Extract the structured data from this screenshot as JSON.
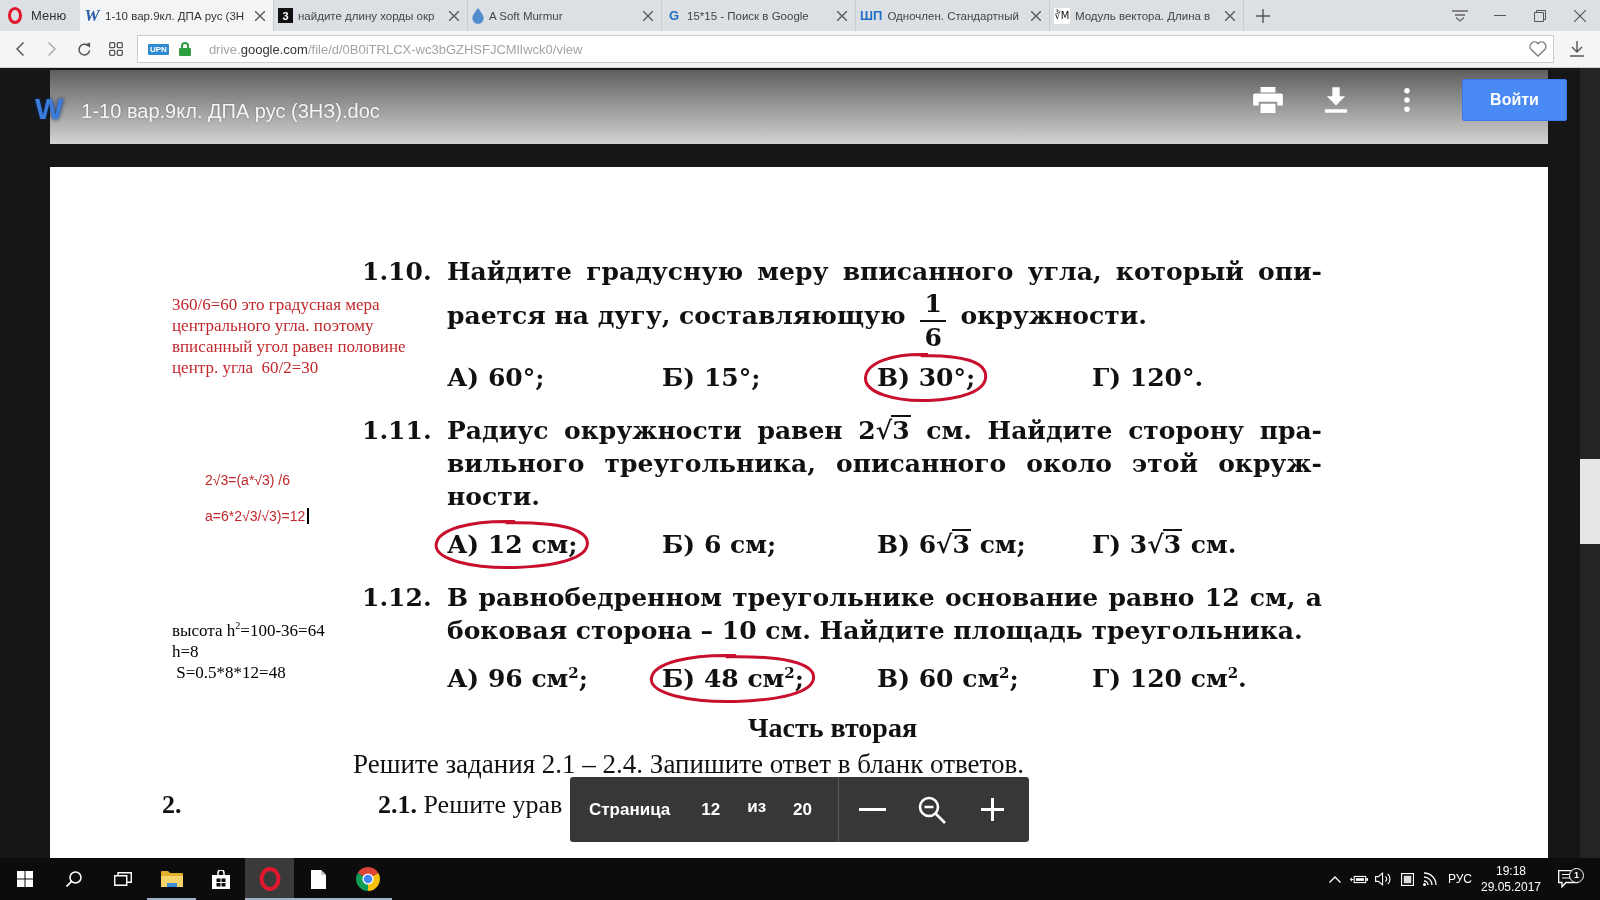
{
  "browser": {
    "menu_label": "Меню",
    "tabs": [
      {
        "label": "1-10 вар.9кл. ДПА рус (3Н",
        "kind": "word",
        "favicon_text": "W",
        "selected": true
      },
      {
        "label": "найдите длину хорды окр",
        "kind": "square",
        "favicon_text": "3",
        "selected": false
      },
      {
        "label": "A Soft Murmur",
        "kind": "drop",
        "selected": false
      },
      {
        "label": "15*15 - Поиск в Google",
        "kind": "letter",
        "favicon_text": "G",
        "selected": false
      },
      {
        "label": "Одночлен. Стандартный",
        "kind": "letter",
        "favicon_text": "ШП",
        "selected": false
      },
      {
        "label": "Модуль вектора. Длина в",
        "kind": "math",
        "favicon_text": "∛M",
        "selected": false
      }
    ],
    "address": {
      "badge": "UPN",
      "secure": true,
      "url": {
        "subdomain": "drive.",
        "domain": "google.com",
        "path": "/file/d/0B0iTRLCX-wc3bGZHSFJCMlIwck0/view"
      }
    }
  },
  "viewer": {
    "logo_text": "W",
    "title": "1-10 вар.9кл. ДПА рус (3НЗ).doc",
    "sign_in": "Войти"
  },
  "document": {
    "questions": [
      {
        "number": "1.10.",
        "lines": [
          [
            {
              "kind": "text",
              "text": "Найдите градусную меру вписанного угла, который опи-"
            }
          ],
          [
            {
              "kind": "text",
              "text": "рается на дугу, составляющую "
            },
            {
              "kind": "fraction",
              "numerator": "1",
              "denominator": "6"
            },
            {
              "kind": "text",
              "text": " окружности."
            }
          ]
        ],
        "answers": [
          {
            "parts": [
              {
                "kind": "text",
                "text": "А) 60°;"
              }
            ],
            "circled": false
          },
          {
            "parts": [
              {
                "kind": "text",
                "text": "Б) 15°;"
              }
            ],
            "circled": false
          },
          {
            "parts": [
              {
                "kind": "text",
                "text": "В) 30°;"
              }
            ],
            "circled": true
          },
          {
            "parts": [
              {
                "kind": "text",
                "text": "Г) 120°."
              }
            ],
            "circled": false
          }
        ],
        "note": {
          "kind": "serif",
          "color": "#c0282d",
          "caret": false,
          "lines": [
            "360/6=60 это градусная мера",
            "центрального угла. поэтому",
            "вписанный угол равен половине",
            "центр. угла  60/2=30"
          ]
        }
      },
      {
        "number": "1.11.",
        "lines": [
          [
            {
              "kind": "text",
              "text": "Радиус окружности равен "
            },
            {
              "kind": "sqrt",
              "coefficient": "2",
              "sign": "√",
              "radicand": "3"
            },
            {
              "kind": "text",
              "text": " см. Найдите сторону пра-"
            }
          ],
          [
            {
              "kind": "text",
              "text": "вильного треугольника, описанного около этой окруж-"
            }
          ],
          [
            {
              "kind": "text",
              "text": "ности."
            }
          ]
        ],
        "answers": [
          {
            "parts": [
              {
                "kind": "text",
                "text": "А) 12 см;"
              }
            ],
            "circled": true
          },
          {
            "parts": [
              {
                "kind": "text",
                "text": "Б) 6 см;"
              }
            ],
            "circled": false
          },
          {
            "parts": [
              {
                "kind": "text",
                "text": "В) "
              },
              {
                "kind": "sqrt",
                "coefficient": "6",
                "sign": "√",
                "radicand": "3"
              },
              {
                "kind": "text",
                "text": " см;"
              }
            ],
            "circled": false
          },
          {
            "parts": [
              {
                "kind": "text",
                "text": "Г) "
              },
              {
                "kind": "sqrt",
                "coefficient": "3",
                "sign": "√",
                "radicand": "3"
              },
              {
                "kind": "text",
                "text": " см."
              }
            ],
            "circled": false
          }
        ],
        "note": {
          "kind": "sans",
          "color": "#c0282d",
          "caret": true,
          "lines": [
            "2√3=(a*√3) /6",
            "a=6*2√3/√3)=12"
          ]
        }
      },
      {
        "number": "1.12.",
        "lines": [
          [
            {
              "kind": "text",
              "text": "В равнобедренном треугольнике основание равно 12 см, а"
            }
          ],
          [
            {
              "kind": "text",
              "text": "боковая сторона – 10 см. Найдите площадь треугольника."
            }
          ]
        ],
        "answers": [
          {
            "parts": [
              {
                "kind": "text",
                "text": "А) 96 см$^{2}$;"
              }
            ],
            "circled": false
          },
          {
            "parts": [
              {
                "kind": "text",
                "text": "Б) 48 см$^{2}$;"
              }
            ],
            "circled": true
          },
          {
            "parts": [
              {
                "kind": "text",
                "text": "В) 60 см$^{2}$;"
              }
            ],
            "circled": false
          },
          {
            "parts": [
              {
                "kind": "text",
                "text": "Г) 120 см$^{2}$."
              }
            ],
            "circled": false
          }
        ],
        "note": {
          "kind": "serif",
          "color": "#000000",
          "caret": false,
          "lines": [
            "высота h$^{2}$=100-36=64",
            "h=8",
            " S=0.5*8*12=48"
          ]
        }
      }
    ],
    "section_title": "Часть вторая",
    "instruction": "Решите задания 2.1 – 2.4. Запишите ответ в бланк ответов.",
    "task_margin_number": "2.",
    "task_text": "**2.1.** Решите урав"
  },
  "page_nav": {
    "label": "Страница",
    "current": "12",
    "separator": "из",
    "total": "20"
  },
  "taskbar": {
    "apps": [
      {
        "kind": "folder",
        "running": true,
        "selected": false
      },
      {
        "kind": "bag",
        "running": false,
        "selected": false
      },
      {
        "kind": "ring",
        "running": true,
        "selected": true
      },
      {
        "kind": "page",
        "running": true,
        "selected": false
      },
      {
        "kind": "circle",
        "running": true,
        "selected": false
      }
    ],
    "language": "РУС",
    "time": "19:18",
    "date": "29.05.2017",
    "notification_count": "1"
  }
}
